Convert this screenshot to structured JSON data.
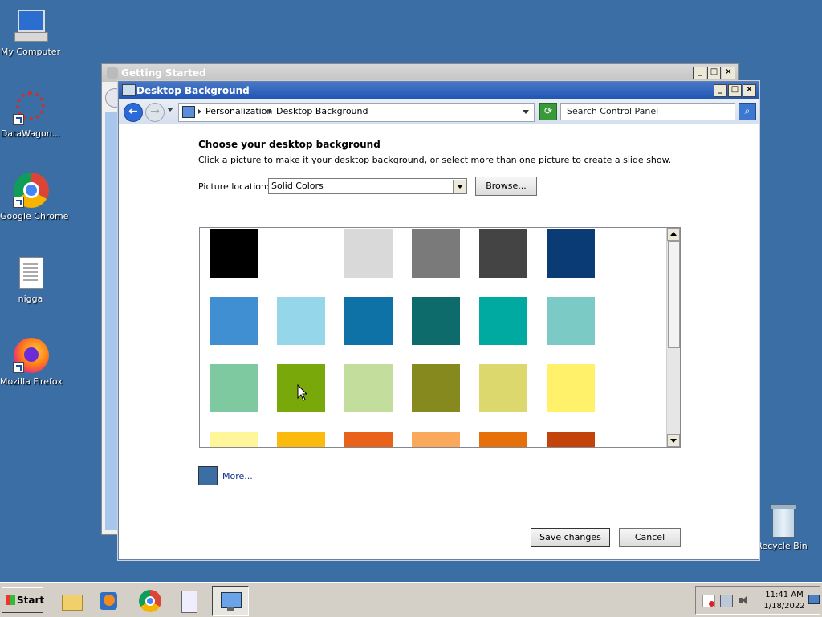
{
  "desktop": {
    "icons": [
      {
        "label": "My Computer"
      },
      {
        "label": "DataWagon..."
      },
      {
        "label": "Google Chrome"
      },
      {
        "label": "nigga"
      },
      {
        "label": "Mozilla Firefox"
      },
      {
        "label": "Recycle Bin"
      }
    ],
    "background_color": "#3a6ea5"
  },
  "back_window": {
    "title": "Getting Started"
  },
  "main_window": {
    "title": "Desktop Background",
    "window_buttons": {
      "minimize": "_",
      "maximize": "□",
      "close": "×"
    },
    "address": {
      "crumbs": [
        "Personalization",
        "Desktop Background"
      ]
    },
    "search": {
      "placeholder": "Search Control Panel"
    },
    "heading": "Choose your desktop background",
    "description": "Click a picture to make it your desktop background, or select more than one picture to create a slide show.",
    "picture_location": {
      "label": "Picture location:",
      "selected": "Solid Colors",
      "browse_label": "Browse..."
    },
    "swatches": [
      [
        "#000000",
        "#ffffff",
        "#d9d9d9",
        "#7a7a7a",
        "#444444",
        "#0b3b75"
      ],
      [
        "#3f8fd2",
        "#96d6ea",
        "#0f72a6",
        "#0d6b6b",
        "#00aaa0",
        "#7bcac6"
      ],
      [
        "#7fc9a0",
        "#78a80a",
        "#c3dd9c",
        "#868a1e",
        "#dcd86e",
        "#fff26a"
      ],
      [
        "#fff59a",
        "#fcba0e",
        "#e8621a",
        "#faa85a",
        "#e6700a",
        "#c2440a"
      ]
    ],
    "more": {
      "label": "More...",
      "color": "#3a6ea5"
    },
    "buttons": {
      "save": "Save changes",
      "cancel": "Cancel"
    }
  },
  "taskbar": {
    "start_label": "Start",
    "items": [
      {
        "icon": "folder-icon"
      },
      {
        "icon": "media-player-icon"
      },
      {
        "icon": "chrome-icon"
      },
      {
        "icon": "document-icon"
      },
      {
        "icon": "control-panel-icon",
        "active": true
      }
    ],
    "clock": {
      "time": "11:41 AM",
      "date": "1/18/2022"
    }
  }
}
